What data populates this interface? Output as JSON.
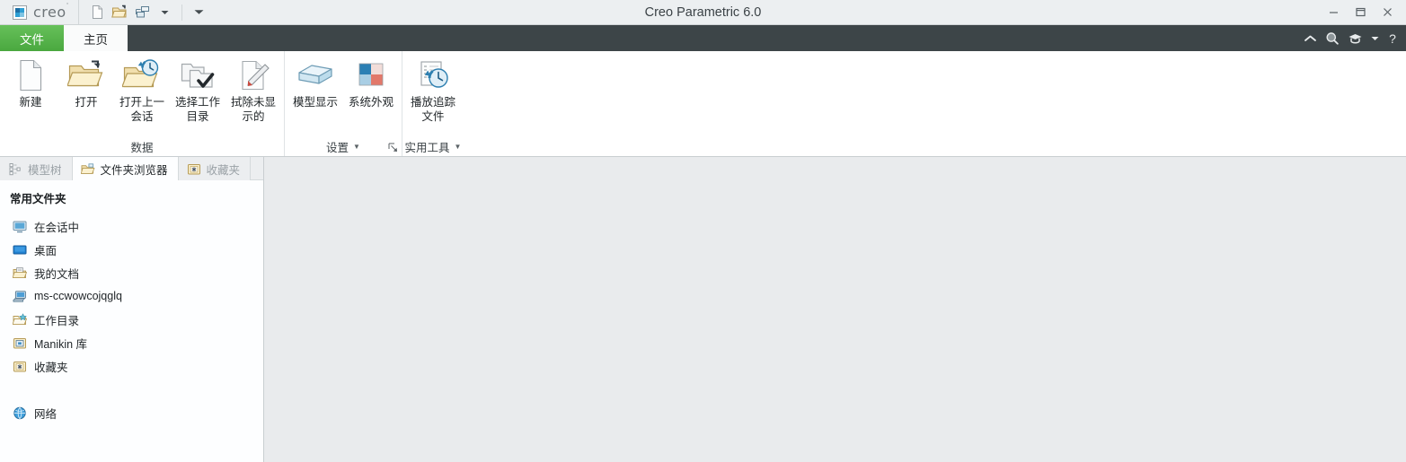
{
  "titlebar": {
    "brand": "creo",
    "brand_sup": "·",
    "window_title": "Creo Parametric 6.0",
    "quick_access": [
      {
        "name": "new-file-icon",
        "label": "新建"
      },
      {
        "name": "open-file-icon",
        "label": "打开"
      },
      {
        "name": "regenerate-icon",
        "label": "重新生成"
      },
      {
        "name": "qat-dropdown-icon",
        "label": "自定义快速访问工具栏"
      }
    ],
    "window_controls": [
      {
        "name": "minimize-button",
        "glyph": "—"
      },
      {
        "name": "maximize-button",
        "glyph": "❐"
      },
      {
        "name": "close-button",
        "glyph": "✕"
      }
    ]
  },
  "tabs": {
    "file": "文件",
    "home": "主页",
    "right_icons": [
      {
        "name": "collapse-ribbon-icon",
        "label": "折叠功能区"
      },
      {
        "name": "search-icon",
        "label": "搜索"
      },
      {
        "name": "learning-icon",
        "label": "学习连接"
      },
      {
        "name": "learning-dropdown-icon",
        "label": "更多"
      },
      {
        "name": "help-icon",
        "label": "帮助"
      }
    ]
  },
  "ribbon": {
    "groups": [
      {
        "title": "数据",
        "has_launcher": false,
        "has_caret": false,
        "buttons": [
          {
            "name": "new-button",
            "label": "新建",
            "icon": "document-new-icon"
          },
          {
            "name": "open-button",
            "label": "打开",
            "icon": "folder-open-icon"
          },
          {
            "name": "open-last-session-button",
            "label": "打开上一会话",
            "icon": "folder-clock-icon"
          },
          {
            "name": "select-working-directory-button",
            "label": "选择工作目录",
            "icon": "folder-check-icon"
          },
          {
            "name": "erase-not-displayed-button",
            "label": "拭除未显示的",
            "icon": "eraser-icon"
          }
        ]
      },
      {
        "title": "设置",
        "has_launcher": true,
        "has_caret": true,
        "buttons": [
          {
            "name": "model-display-button",
            "label": "模型显示",
            "icon": "cube-icon"
          },
          {
            "name": "system-appearance-button",
            "label": "系统外观",
            "icon": "color-swatch-icon"
          }
        ]
      },
      {
        "title": "实用工具",
        "has_launcher": false,
        "has_caret": true,
        "buttons": [
          {
            "name": "play-trace-file-button",
            "label": "播放追踪文件",
            "icon": "play-trace-icon"
          }
        ]
      }
    ]
  },
  "navigator": {
    "tabs": [
      {
        "name": "tab-model-tree",
        "label": "模型树",
        "icon": "model-tree-icon",
        "state": "inactive"
      },
      {
        "name": "tab-folder-browser",
        "label": "文件夹浏览器",
        "icon": "folder-browser-icon",
        "state": "active"
      },
      {
        "name": "tab-favorites",
        "label": "收藏夹",
        "icon": "favorites-folder-icon",
        "state": "inactive"
      }
    ],
    "section_title": "常用文件夹",
    "items": [
      {
        "name": "folder-in-session",
        "label": "在会话中",
        "icon": "monitor-icon"
      },
      {
        "name": "folder-desktop",
        "label": "桌面",
        "icon": "desktop-icon"
      },
      {
        "name": "folder-my-documents",
        "label": "我的文档",
        "icon": "documents-folder-icon"
      },
      {
        "name": "folder-computer",
        "label": "ms-ccwowcojqglq",
        "icon": "computer-icon"
      },
      {
        "name": "folder-working-directory",
        "label": "工作目录",
        "icon": "working-directory-icon"
      },
      {
        "name": "folder-manikin-library",
        "label": "Manikin 库",
        "icon": "manikin-library-icon"
      },
      {
        "name": "folder-favorites",
        "label": "收藏夹",
        "icon": "favorites-folder-icon"
      }
    ],
    "network": {
      "name": "folder-network",
      "label": "网络",
      "icon": "globe-icon"
    }
  },
  "colors": {
    "file_tab_green": "#4aa83f",
    "tabstrip_dark": "#3d4548",
    "canvas_gray": "#e9ebed",
    "sidebar_white": "#fdfeff"
  }
}
